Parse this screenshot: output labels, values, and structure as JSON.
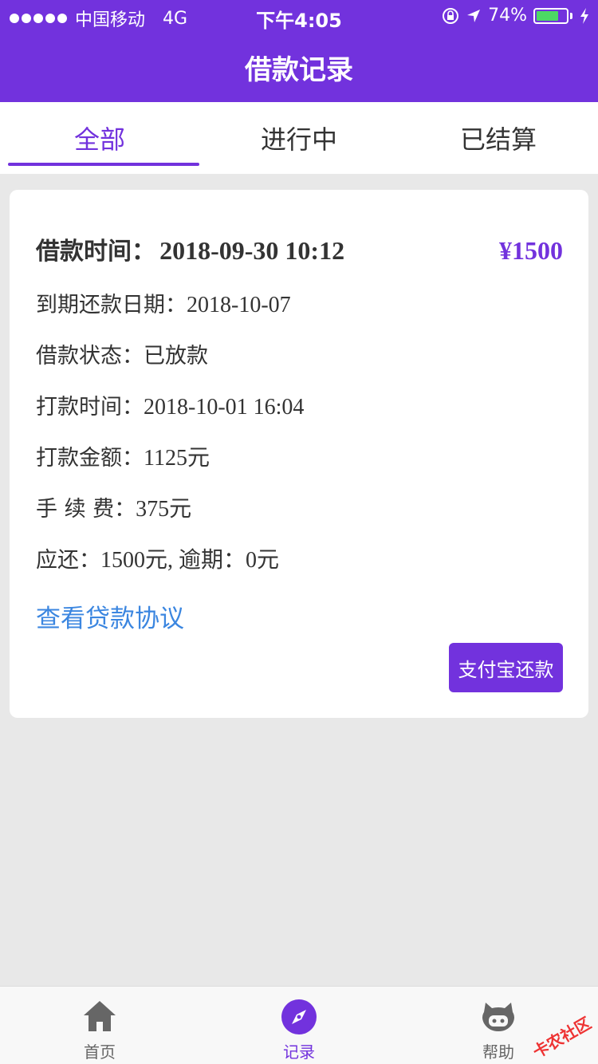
{
  "status_bar": {
    "carrier": "中国移动",
    "network": "4G",
    "time": "下午4:05",
    "battery": "74%",
    "battery_level": 0.74
  },
  "header": {
    "title": "借款记录"
  },
  "tabs": [
    {
      "label": "全部",
      "active": true
    },
    {
      "label": "进行中",
      "active": false
    },
    {
      "label": "已结算",
      "active": false
    }
  ],
  "record": {
    "borrow_time_label": "借款时间：",
    "borrow_time_value": "2018-09-30 10:12",
    "amount": "¥1500",
    "due_label": "到期还款日期：",
    "due_value": "2018-10-07",
    "status_label": "借款状态：",
    "status_value": "已放款",
    "transfer_time_label": "打款时间：",
    "transfer_time_value": "2018-10-01 16:04",
    "transfer_amount_label": "打款金额：",
    "transfer_amount_value": "1125元",
    "fee_label": "手 续 费：",
    "fee_value": "375元",
    "repay_label": "应还：",
    "repay_value": "1500元, 逾期：0元",
    "agreement_link": "查看贷款协议",
    "pay_button": "支付宝还款"
  },
  "bottom_nav": [
    {
      "label": "首页",
      "icon": "home-icon",
      "active": false
    },
    {
      "label": "记录",
      "icon": "compass-icon",
      "active": true
    },
    {
      "label": "帮助",
      "icon": "github-cat-icon",
      "active": false
    }
  ],
  "watermark": "卡农社区",
  "colors": {
    "brand": "#7232dd",
    "link": "#3b86e0",
    "background": "#e8e8e8"
  }
}
